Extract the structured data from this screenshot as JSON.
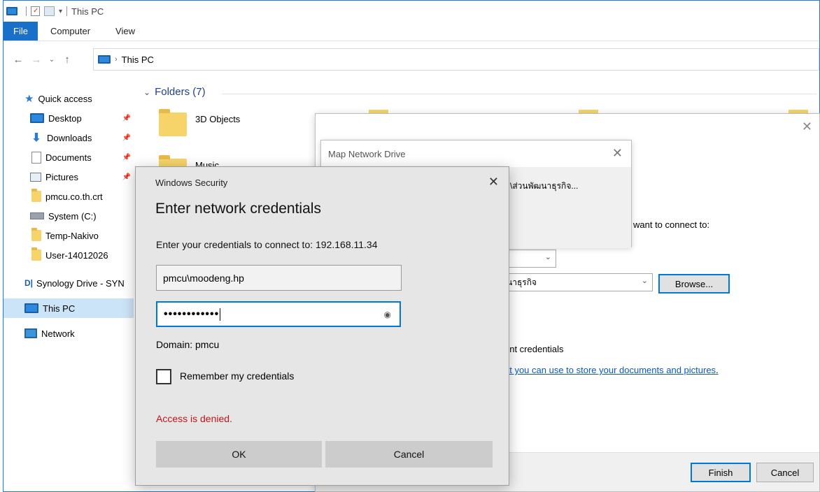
{
  "window": {
    "title": "This PC"
  },
  "ribbon": {
    "tabs": [
      "File",
      "Computer",
      "View"
    ]
  },
  "address": {
    "path": "This PC"
  },
  "nav": {
    "quick_access": "Quick access",
    "items": [
      {
        "label": "Desktop",
        "icon": "desktop-icon",
        "pinned": true
      },
      {
        "label": "Downloads",
        "icon": "downloads-icon",
        "pinned": true
      },
      {
        "label": "Documents",
        "icon": "documents-icon",
        "pinned": true
      },
      {
        "label": "Pictures",
        "icon": "pictures-icon",
        "pinned": true
      },
      {
        "label": "pmcu.co.th.crt",
        "icon": "folder-icon",
        "pinned": false
      },
      {
        "label": "System (C:)",
        "icon": "drive-icon",
        "pinned": false
      },
      {
        "label": "Temp-Nakivo",
        "icon": "folder-icon",
        "pinned": false
      },
      {
        "label": "User-14012026",
        "icon": "folder-icon",
        "pinned": false
      }
    ],
    "synology": "Synology Drive - SYN",
    "this_pc": "This PC",
    "network": "Network"
  },
  "content": {
    "folders_header": "Folders (7)",
    "folders": [
      "3D Objects",
      "Music"
    ]
  },
  "map_drive_popup": {
    "title": "Map Network Drive",
    "text": "\\ส่วนพัฒนาธุรกิจ..."
  },
  "wizard": {
    "prompt_fragment": "want to connect to:",
    "folder_value": "นาธุรกิจ",
    "browse_label": "Browse...",
    "credentials_fragment": "ent credentials",
    "link_fragment": "at you can use to store your documents and pictures",
    "link_period": ".",
    "finish_label": "Finish",
    "cancel_label": "Cancel"
  },
  "security": {
    "title": "Windows Security",
    "heading": "Enter network credentials",
    "prompt": "Enter your credentials to connect to: 192.168.11.34",
    "username": "pmcu\\moodeng.hp",
    "password_mask": "••••••••••••",
    "domain": "Domain: pmcu",
    "remember_label": "Remember my credentials",
    "remember_checked": false,
    "error": "Access is denied.",
    "ok_label": "OK",
    "cancel_label": "Cancel",
    "error_color": "#c4141a"
  }
}
